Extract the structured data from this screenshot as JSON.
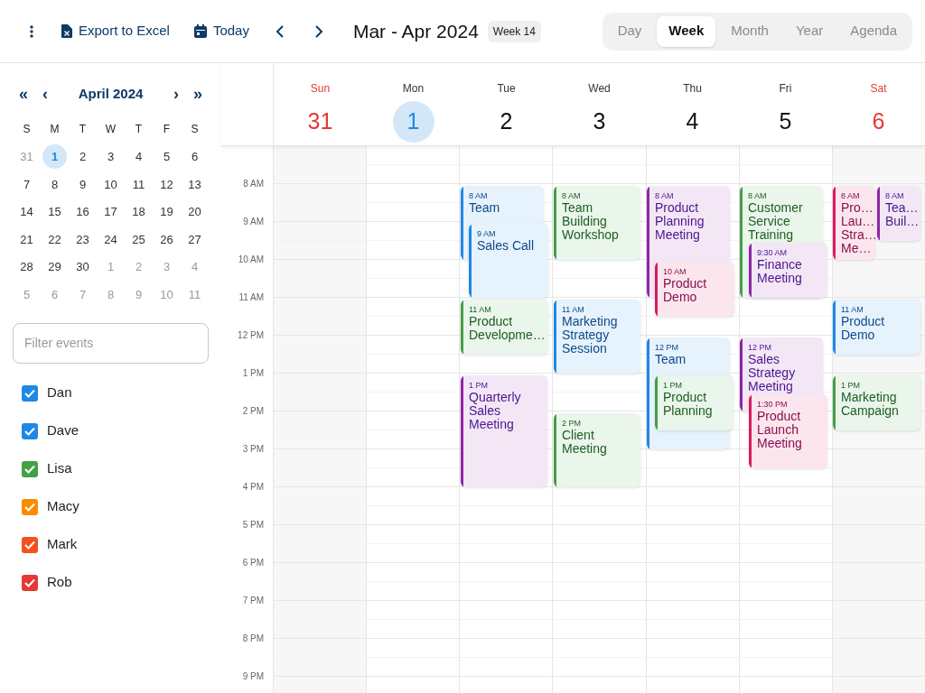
{
  "toolbar": {
    "export_label": "Export to Excel",
    "today_label": "Today",
    "range_title": "Mar - Apr 2024",
    "week_badge": "Week 14"
  },
  "views": [
    {
      "label": "Day",
      "selected": false
    },
    {
      "label": "Week",
      "selected": true
    },
    {
      "label": "Month",
      "selected": false
    },
    {
      "label": "Year",
      "selected": false
    },
    {
      "label": "Agenda",
      "selected": false
    }
  ],
  "mini_calendar": {
    "title": "April 2024",
    "prev_year": "«",
    "prev_month": "‹",
    "next_month": "›",
    "next_year": "»",
    "weekdays": [
      "S",
      "M",
      "T",
      "W",
      "T",
      "F",
      "S"
    ],
    "weeks": [
      [
        {
          "label": "31",
          "muted": true,
          "selected": false
        },
        {
          "label": "1",
          "muted": false,
          "selected": true
        },
        {
          "label": "2",
          "muted": false,
          "selected": false
        },
        {
          "label": "3",
          "muted": false,
          "selected": false
        },
        {
          "label": "4",
          "muted": false,
          "selected": false
        },
        {
          "label": "5",
          "muted": false,
          "selected": false
        },
        {
          "label": "6",
          "muted": false,
          "selected": false
        }
      ],
      [
        {
          "label": "7",
          "muted": false,
          "selected": false
        },
        {
          "label": "8",
          "muted": false,
          "selected": false
        },
        {
          "label": "9",
          "muted": false,
          "selected": false
        },
        {
          "label": "10",
          "muted": false,
          "selected": false
        },
        {
          "label": "11",
          "muted": false,
          "selected": false
        },
        {
          "label": "12",
          "muted": false,
          "selected": false
        },
        {
          "label": "13",
          "muted": false,
          "selected": false
        }
      ],
      [
        {
          "label": "14",
          "muted": false,
          "selected": false
        },
        {
          "label": "15",
          "muted": false,
          "selected": false
        },
        {
          "label": "16",
          "muted": false,
          "selected": false
        },
        {
          "label": "17",
          "muted": false,
          "selected": false
        },
        {
          "label": "18",
          "muted": false,
          "selected": false
        },
        {
          "label": "19",
          "muted": false,
          "selected": false
        },
        {
          "label": "20",
          "muted": false,
          "selected": false
        }
      ],
      [
        {
          "label": "21",
          "muted": false,
          "selected": false
        },
        {
          "label": "22",
          "muted": false,
          "selected": false
        },
        {
          "label": "23",
          "muted": false,
          "selected": false
        },
        {
          "label": "24",
          "muted": false,
          "selected": false
        },
        {
          "label": "25",
          "muted": false,
          "selected": false
        },
        {
          "label": "26",
          "muted": false,
          "selected": false
        },
        {
          "label": "27",
          "muted": false,
          "selected": false
        }
      ],
      [
        {
          "label": "28",
          "muted": false,
          "selected": false
        },
        {
          "label": "29",
          "muted": false,
          "selected": false
        },
        {
          "label": "30",
          "muted": false,
          "selected": false
        },
        {
          "label": "1",
          "muted": true,
          "selected": false
        },
        {
          "label": "2",
          "muted": true,
          "selected": false
        },
        {
          "label": "3",
          "muted": true,
          "selected": false
        },
        {
          "label": "4",
          "muted": true,
          "selected": false
        }
      ],
      [
        {
          "label": "5",
          "muted": true,
          "selected": false
        },
        {
          "label": "6",
          "muted": true,
          "selected": false
        },
        {
          "label": "7",
          "muted": true,
          "selected": false
        },
        {
          "label": "8",
          "muted": true,
          "selected": false
        },
        {
          "label": "9",
          "muted": true,
          "selected": false
        },
        {
          "label": "10",
          "muted": true,
          "selected": false
        },
        {
          "label": "11",
          "muted": true,
          "selected": false
        }
      ]
    ]
  },
  "filter": {
    "placeholder": "Filter events"
  },
  "people": [
    {
      "name": "Dan",
      "checked": true,
      "color": "#1e88e5"
    },
    {
      "name": "Dave",
      "checked": true,
      "color": "#1e88e5"
    },
    {
      "name": "Lisa",
      "checked": true,
      "color": "#43a047"
    },
    {
      "name": "Macy",
      "checked": true,
      "color": "#fb8c00"
    },
    {
      "name": "Mark",
      "checked": true,
      "color": "#f4511e"
    },
    {
      "name": "Rob",
      "checked": true,
      "color": "#e53935"
    }
  ],
  "days": [
    {
      "name": "Sun",
      "number": "31",
      "weekend": true,
      "selected": false
    },
    {
      "name": "Mon",
      "number": "1",
      "weekend": false,
      "selected": true
    },
    {
      "name": "Tue",
      "number": "2",
      "weekend": false,
      "selected": false
    },
    {
      "name": "Wed",
      "number": "3",
      "weekend": false,
      "selected": false
    },
    {
      "name": "Thu",
      "number": "4",
      "weekend": false,
      "selected": false
    },
    {
      "name": "Fri",
      "number": "5",
      "weekend": false,
      "selected": false
    },
    {
      "name": "Sat",
      "number": "6",
      "weekend": true,
      "selected": false
    }
  ],
  "time_labels": [
    "8 AM",
    "9 AM",
    "10 AM",
    "11 AM",
    "12 PM",
    "1 PM",
    "2 PM",
    "3 PM",
    "4 PM",
    "5 PM",
    "6 PM",
    "7 PM",
    "8 PM",
    "9 PM"
  ],
  "events": [
    {
      "time": "8 AM",
      "title": "Team",
      "color": "#1e88e5"
    },
    {
      "time": "9 AM",
      "title": "Sales Call",
      "color": "#1e88e5"
    },
    {
      "time": "11 AM",
      "title": "Product Developme…",
      "color": "#43a047"
    },
    {
      "time": "1 PM",
      "title": "Quarterly Sales Meeting",
      "color": "#8e24aa"
    },
    {
      "time": "8 AM",
      "title": "Team Building Workshop",
      "color": "#43a047"
    },
    {
      "time": "11 AM",
      "title": "Marketing Strategy Session",
      "color": "#1e88e5"
    },
    {
      "time": "2 PM",
      "title": "Client Meeting",
      "color": "#43a047"
    },
    {
      "time": "8 AM",
      "title": "Product Planning Meeting",
      "color": "#8e24aa"
    },
    {
      "time": "10 AM",
      "title": "Product Demo",
      "color": "#d81b60"
    },
    {
      "time": "12 PM",
      "title": "Team",
      "color": "#1e88e5"
    },
    {
      "time": "1 PM",
      "title": "Product Planning",
      "color": "#43a047"
    },
    {
      "time": "8 AM",
      "title": "Customer Service Training",
      "color": "#43a047"
    },
    {
      "time": "9:30 AM",
      "title": "Finance Meeting",
      "color": "#8e24aa"
    },
    {
      "time": "12 PM",
      "title": "Sales Strategy Meeting",
      "color": "#8e24aa"
    },
    {
      "time": "1:30 PM",
      "title": "Product Launch Meeting",
      "color": "#d81b60"
    },
    {
      "time": "8 AM",
      "title": "Pro… Lau… Stra… Me…",
      "color": "#d81b60"
    },
    {
      "time": "8 AM",
      "title": "Tea… Buil…",
      "color": "#8e24aa"
    },
    {
      "time": "11 AM",
      "title": "Product Demo",
      "color": "#1e88e5"
    },
    {
      "time": "1 PM",
      "title": "Marketing Campaign",
      "color": "#43a047"
    }
  ]
}
